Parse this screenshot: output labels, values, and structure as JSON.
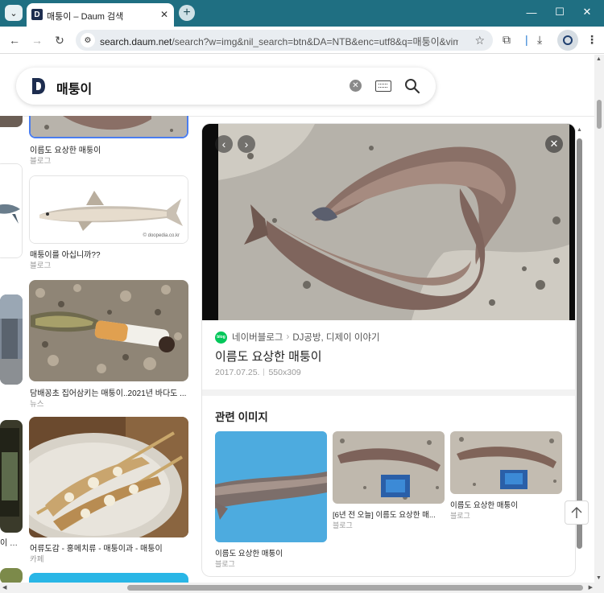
{
  "browser": {
    "tab_title": "매퉁이 – Daum 검색",
    "tab_favicon": "D",
    "url_host": "search.daum.net",
    "url_rest": "/search?w=img&nil_search=btn&DA=NTB&enc=utf8&q=매퉁이&vimg...",
    "icons": {
      "tab_menu": "chevron-down-icon",
      "new_tab": "plus-icon",
      "minimize": "minimize-icon",
      "maximize": "maximize-icon",
      "close": "close-icon",
      "back": "back-arrow-icon",
      "forward": "forward-arrow-icon",
      "reload": "reload-icon",
      "site_info": "tune-icon",
      "bookmark": "star-icon",
      "extensions": "puzzle-icon",
      "download": "download-icon",
      "profile": "profile-icon",
      "menu": "kebab-menu-icon"
    }
  },
  "search": {
    "query": "매퉁이",
    "logo": "D",
    "icons": {
      "clear": "clear-icon",
      "keyboard": "keyboard-icon",
      "search": "search-icon"
    }
  },
  "results_left": [
    {
      "title": "이름도 요상한 매퉁이",
      "source": "블로그"
    },
    {
      "title": "매퉁이를 아십니까??",
      "source": "블로그",
      "watermark": "© doopedia.co.kr"
    },
    {
      "title": "담배꽁초 집어삼키는 매퉁이..2021년 바다도 ...",
      "source": "뉴스"
    },
    {
      "title": "어류도감 - 홍메치류 - 매퉁이과 - 매퉁이",
      "source": "카페"
    }
  ],
  "left_edge_fragment": {
    "text": "이 해..."
  },
  "detail": {
    "blog_badge": "blog",
    "source_name": "네이버블로그",
    "source_path": "DJ공방, 디제이 이야기",
    "title": "이름도 요상한 매퉁이",
    "date": "2017.07.25.",
    "size": "550x309",
    "related_heading": "관련 이미지",
    "related": [
      {
        "caption": "이름도 요상한 매퉁이",
        "source": "블로그"
      },
      {
        "caption": "[6년 전 오늘] 이름도 요상한 매...",
        "source": "블로그"
      },
      {
        "caption": "이름도 요상한 매퉁이",
        "source": "블로그"
      }
    ],
    "icons": {
      "prev": "chevron-left-icon",
      "next": "chevron-right-icon",
      "close": "close-icon"
    }
  },
  "page_icons": {
    "scroll_top": "arrow-up-icon"
  }
}
